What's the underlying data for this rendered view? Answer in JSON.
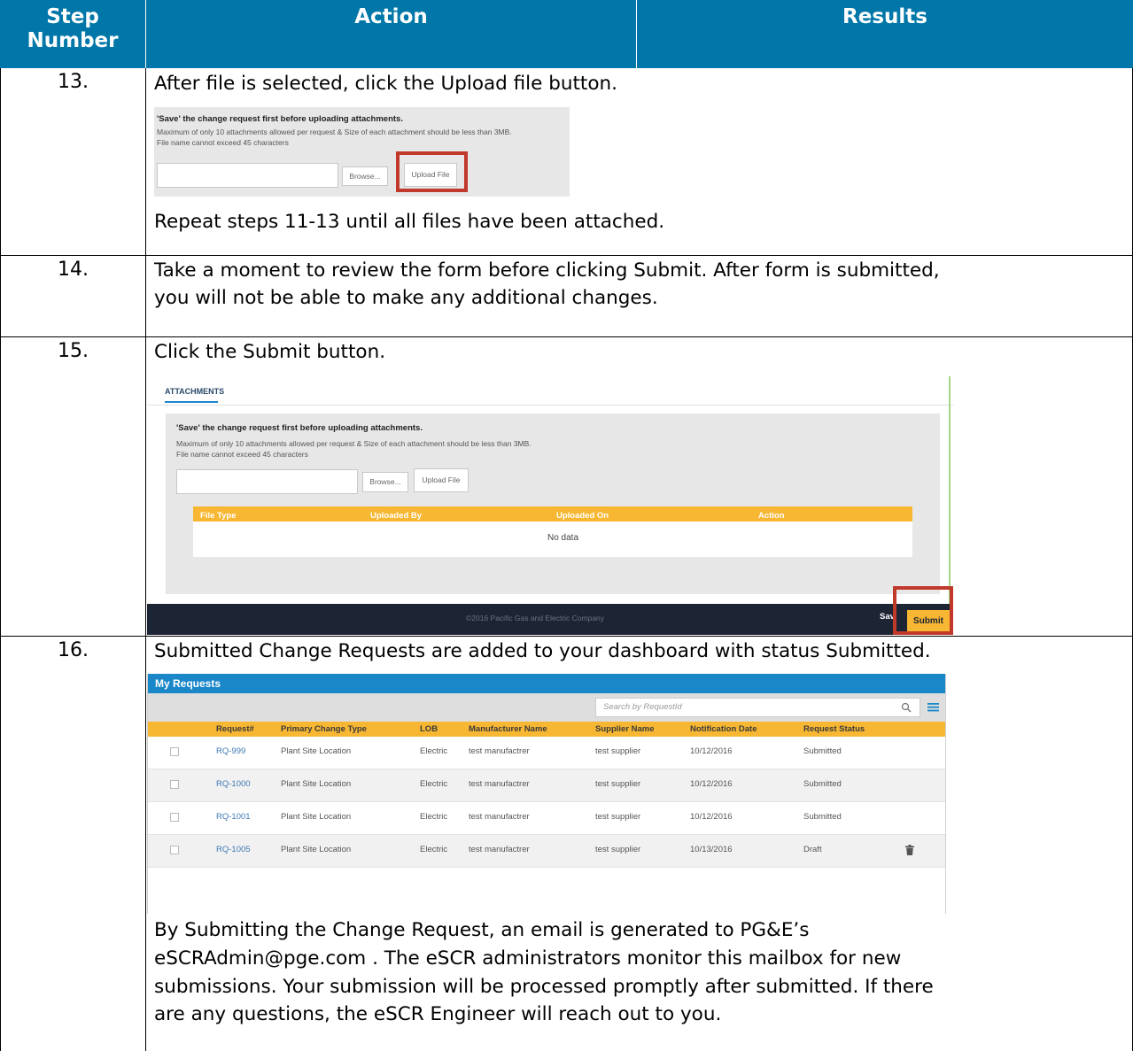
{
  "table": {
    "headers": {
      "step": "Step Number",
      "action": "Action",
      "results": "Results"
    },
    "rows": [
      {
        "number": "13.",
        "instruction": "After file is selected, click the Upload file button.",
        "note": "Repeat steps 11-13 until all files have been attached."
      },
      {
        "number": "14.",
        "line1": "Take a moment to review the form before clicking Submit. After form is submitted,",
        "line2": "you will not be able to make any additional changes."
      },
      {
        "number": "15.",
        "instruction": "Click the Submit button."
      },
      {
        "number": "16.",
        "instruction": "Submitted Change Requests are added to your dashboard with status Submitted.",
        "para": [
          "By Submitting the Change Request, an email is generated to PG&E’s",
          "eSCRAdmin@pge.com . The eSCR administrators monitor this mailbox for new",
          "submissions. Your submission will be processed promptly after submitted. If there",
          "are any questions, the eSCR Engineer will reach out to you."
        ]
      }
    ]
  },
  "upload_panel": {
    "warning": "'Save' the change request first before uploading attachments.",
    "limit": "Maximum of only 10 attachments allowed per request & Size of each attachment should be less than 3MB.",
    "name_limit": "File name cannot exceed 45 characters",
    "browse": "Browse...",
    "upload": "Upload File"
  },
  "attachments": {
    "tab": "ATTACHMENTS",
    "columns": [
      "File Type",
      "Uploaded By",
      "Uploaded On",
      "Action"
    ],
    "empty": "No data",
    "footer": "©2016 Pacific Gas and Electric Company",
    "save": "Sav",
    "submit": "Submit",
    "colors": {
      "grid_header": "#f7b733",
      "footer": "#1d2433",
      "highlight": "#c0392b"
    }
  },
  "my_requests": {
    "title": "My Requests",
    "search_placeholder": "Search by RequestId",
    "columns": [
      "Request#",
      "Primary Change Type",
      "LOB",
      "Manufacturer Name",
      "Supplier Name",
      "Notification Date",
      "Request Status"
    ],
    "rows": [
      {
        "id": "RQ-999",
        "type": "Plant Site Location",
        "lob": "Electric",
        "mfr": "test manufactrer",
        "supplier": "test supplier",
        "date": "10/12/2016",
        "status": "Submitted"
      },
      {
        "id": "RQ-1000",
        "type": "Plant Site Location",
        "lob": "Electric",
        "mfr": "test manufactrer",
        "supplier": "test supplier",
        "date": "10/12/2016",
        "status": "Submitted"
      },
      {
        "id": "RQ-1001",
        "type": "Plant Site Location",
        "lob": "Electric",
        "mfr": "test manufactrer",
        "supplier": "test supplier",
        "date": "10/12/2016",
        "status": "Submitted"
      },
      {
        "id": "RQ-1005",
        "type": "Plant Site Location",
        "lob": "Electric",
        "mfr": "test manufactrer",
        "supplier": "test supplier",
        "date": "10/13/2016",
        "status": "Draft"
      }
    ],
    "colors": {
      "title_bar": "#1a87c9",
      "header": "#f7b733",
      "link": "#3f79b5"
    }
  },
  "theme": {
    "table_header": "#0077a8"
  }
}
